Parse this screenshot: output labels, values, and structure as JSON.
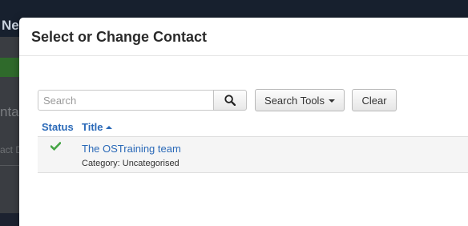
{
  "background": {
    "brand_fragment": "Ne",
    "heading_fragment": "nta",
    "small_fragment": "act D"
  },
  "modal": {
    "title": "Select or Change Contact",
    "search": {
      "placeholder": "Search",
      "value": ""
    },
    "search_tools_label": "Search Tools",
    "clear_label": "Clear",
    "columns": {
      "status": "Status",
      "title": "Title"
    },
    "sort": {
      "column": "title",
      "direction": "ascending"
    },
    "rows": [
      {
        "status": "published",
        "title": "The OSTraining team",
        "category": "Category: Uncategorised"
      }
    ]
  },
  "colors": {
    "link": "#2a69b8",
    "check": "#46a546"
  },
  "icons": [
    "search-icon",
    "caret-down-icon",
    "sort-ascending-icon",
    "published-check-icon"
  ]
}
